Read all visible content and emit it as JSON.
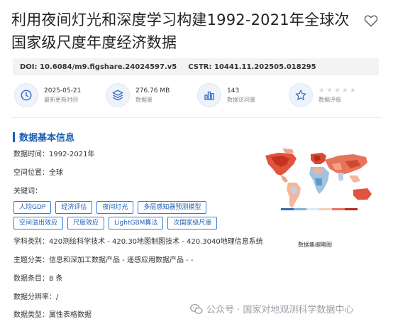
{
  "dataset": {
    "title": "利用夜间灯光和深度学习构建1992-2021年全球次国家级尺度年度经济数据",
    "doi_label": "DOI:",
    "doi": "10.6084/m9.figshare.24024597.v5",
    "cstr_label": "CSTR:",
    "cstr": "10441.11.202505.018295"
  },
  "stats": [
    {
      "value": "2025-05-21",
      "label": "最新更新时间",
      "icon": "clock-icon"
    },
    {
      "value": "276.76 MB",
      "label": "数据量",
      "icon": "layers-icon"
    },
    {
      "value": "143",
      "label": "数据访问量",
      "icon": "bar-chart-icon"
    },
    {
      "value": "",
      "label": "数据评级",
      "icon": "star-icon",
      "rating": 0
    }
  ],
  "section": {
    "title": "数据基本信息"
  },
  "info": {
    "time_label": "数据时间：",
    "time_value": "1992-2021年",
    "location_label": "空间位置：",
    "location_value": "全球",
    "keywords_label": "关键词：",
    "keywords": [
      "人均GDP",
      "经济评估",
      "夜间灯光",
      "多层感知器预测模型",
      "空间溢出效应",
      "尺度效应",
      "LightGBM算法",
      "次国家级尺度"
    ],
    "subject_label": "学科类别：",
    "subject_value": "420测绘科学技术 - 420.30地图制图技术 - 420.3040地理信息系统",
    "theme_label": "主题分类：",
    "theme_value": "信息和深加工数据产品 - 遥感应用数据产品 - -",
    "count_label": "数据条目：",
    "count_value": "8 条",
    "resolution_label": "数据分辨率：",
    "resolution_value": "/",
    "type_label": "数据类型：",
    "type_value": "属性表格数据"
  },
  "map": {
    "caption": "数据集缩略图"
  },
  "watermark": {
    "text": "公众号 · 国家对地观测科学数据中心"
  },
  "colors": {
    "accent": "#1a5fb4",
    "tag_border": "#3a7bd5",
    "doi_bg": "#f2f3f5"
  }
}
